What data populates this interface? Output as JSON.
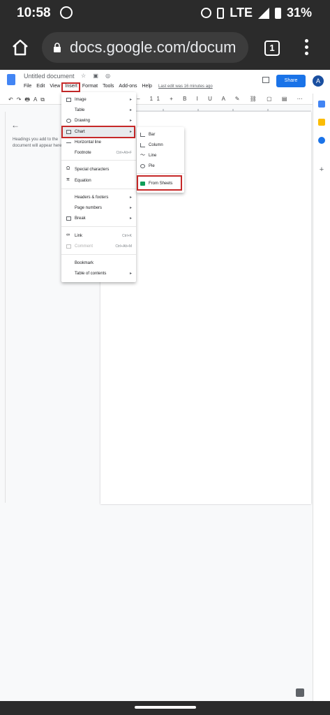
{
  "status_bar": {
    "time": "10:58",
    "network": "LTE",
    "battery": "31%",
    "icons": [
      "whatsapp-icon",
      "alarm-icon",
      "vibrate-icon",
      "signal-icon",
      "battery-icon"
    ]
  },
  "browser": {
    "url": "docs.google.com/docum",
    "tab_count": "1"
  },
  "docs": {
    "title": "Untitled document",
    "menus": [
      "File",
      "Edit",
      "View",
      "Insert",
      "Format",
      "Tools",
      "Add-ons",
      "Help"
    ],
    "last_edit": "Last edit was 16 minutes ago",
    "share_label": "Share",
    "avatar_letter": "A",
    "outline_hint": "Headings you add to the document will appear here.",
    "accent_color": "#1a73e8",
    "highlight_color": "#c62828"
  },
  "insert_menu": {
    "image": "Image",
    "table": "Table",
    "drawing": "Drawing",
    "chart": "Chart",
    "horizontal_line": "Horizontal line",
    "footnote": "Footnote",
    "footnote_shortcut": "Ctrl+Alt+F",
    "special_characters": "Special characters",
    "equation": "Equation",
    "headers_footers": "Headers & footers",
    "page_numbers": "Page numbers",
    "break": "Break",
    "link": "Link",
    "link_shortcut": "Ctrl+K",
    "comment": "Comment",
    "comment_shortcut": "Ctrl+Alt+M",
    "bookmark": "Bookmark",
    "table_of_contents": "Table of contents"
  },
  "chart_submenu": {
    "bar": "Bar",
    "column": "Column",
    "line": "Line",
    "pie": "Pie",
    "from_sheets": "From Sheets"
  }
}
